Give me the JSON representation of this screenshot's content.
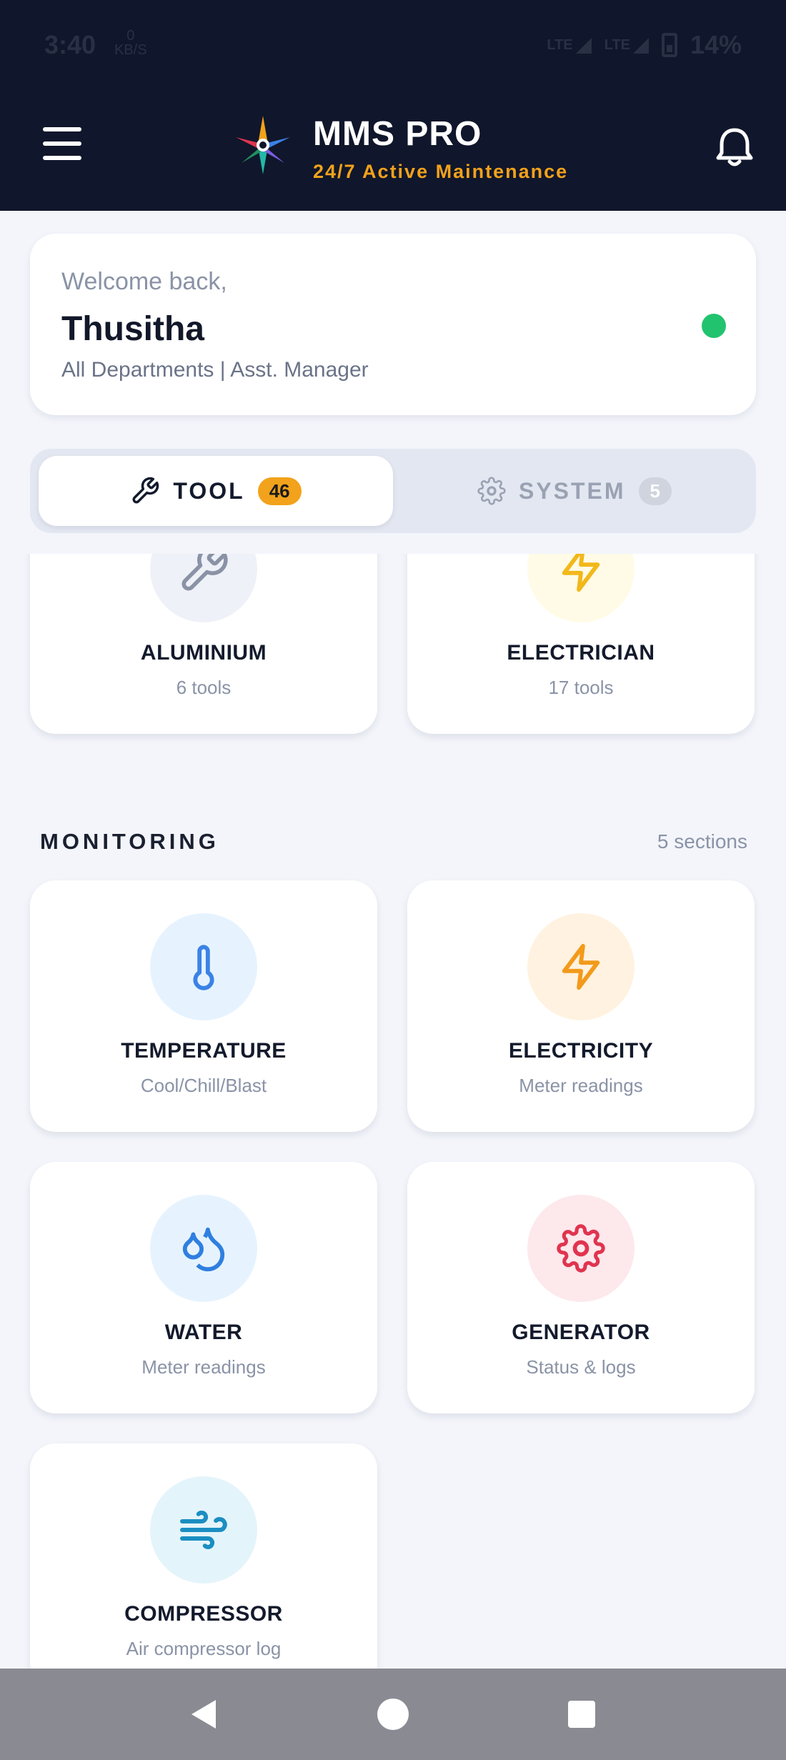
{
  "status_bar": {
    "time": "3:40",
    "data_icon_top": "0",
    "data_icon_bottom": "KB/S",
    "network_1": "LTE",
    "network_2": "LTE",
    "battery": "14%"
  },
  "header": {
    "title": "MMS PRO",
    "subtitle": "24/7 Active Maintenance",
    "logo_icon": "compass-star-icon",
    "menu_icon": "hamburger-menu-icon",
    "bell_icon": "bell-icon",
    "accent": "#f2a21b",
    "background": "#10162b"
  },
  "welcome": {
    "greeting": "Welcome back,",
    "name": "Thusitha",
    "role": "All Departments | Asst. Manager",
    "status_color": "#22c36e"
  },
  "tabs": [
    {
      "label": "TOOL",
      "count": "46",
      "icon": "wrench-icon",
      "active": true
    },
    {
      "label": "SYSTEM",
      "count": "5",
      "icon": "gear-icon",
      "active": false
    }
  ],
  "tool_cards": [
    {
      "title": "ALUMINIUM",
      "subtitle": "6 tools",
      "icon": "wrench-icon",
      "circle": "#eef1f7",
      "color": "#8a93a6"
    },
    {
      "title": "ELECTRICIAN",
      "subtitle": "17 tools",
      "icon": "lightning-icon",
      "circle": "#fffbe6",
      "color": "#f2b81b"
    }
  ],
  "monitoring": {
    "heading": "MONITORING",
    "count": "5 sections",
    "cards": [
      {
        "title": "TEMPERATURE",
        "subtitle": "Cool/Chill/Blast",
        "icon": "thermometer-icon",
        "circle": "#e6f3ff",
        "color": "#3b82e6"
      },
      {
        "title": "ELECTRICITY",
        "subtitle": "Meter readings",
        "icon": "lightning-icon",
        "circle": "#fff2e0",
        "color": "#f29a1b"
      },
      {
        "title": "WATER",
        "subtitle": "Meter readings",
        "icon": "water-drops-icon",
        "circle": "#e6f3ff",
        "color": "#2f7fe0"
      },
      {
        "title": "GENERATOR",
        "subtitle": "Status & logs",
        "icon": "gear-icon",
        "circle": "#fde8ec",
        "color": "#e0344f"
      },
      {
        "title": "COMPRESSOR",
        "subtitle": "Air compressor log",
        "icon": "wind-icon",
        "circle": "#e4f4fb",
        "color": "#1b8ec2"
      }
    ]
  },
  "nav": {
    "back_icon": "back-triangle-icon",
    "home_icon": "home-circle-icon",
    "recent_icon": "recent-square-icon"
  }
}
